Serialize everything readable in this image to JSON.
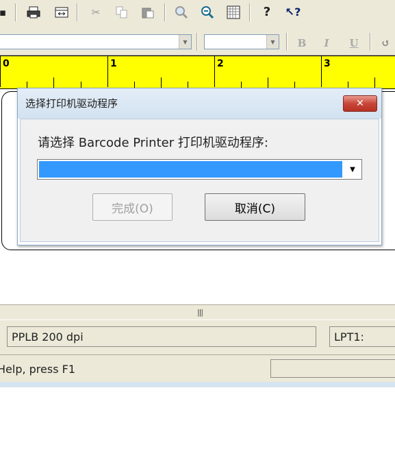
{
  "toolbar": {
    "icons": [
      "save-icon",
      "print-icon",
      "fit-page-icon",
      "cut-icon",
      "copy-icon",
      "paste-icon",
      "zoom-in-icon",
      "zoom-out-icon",
      "grid-icon",
      "help-icon",
      "context-help-icon"
    ]
  },
  "format_toolbar": {
    "font_name_value": "",
    "font_size_value": "",
    "bold_label": "B",
    "italic_label": "I",
    "underline_label": "U"
  },
  "ruler": {
    "labels": [
      "0",
      "1",
      "2",
      "3"
    ],
    "color": "#ffff00"
  },
  "dialog": {
    "title": "选择打印机驱动程序",
    "close_label": "✕",
    "prompt": "请选择 Barcode Printer 打印机驱动程序:",
    "driver_select_value": "",
    "finish_button": "完成(O)",
    "cancel_button": "取消(C)"
  },
  "info": {
    "printer_model": "PPLB 200 dpi",
    "port": "LPT1:"
  },
  "status": {
    "help_text": "Help, press F1"
  }
}
